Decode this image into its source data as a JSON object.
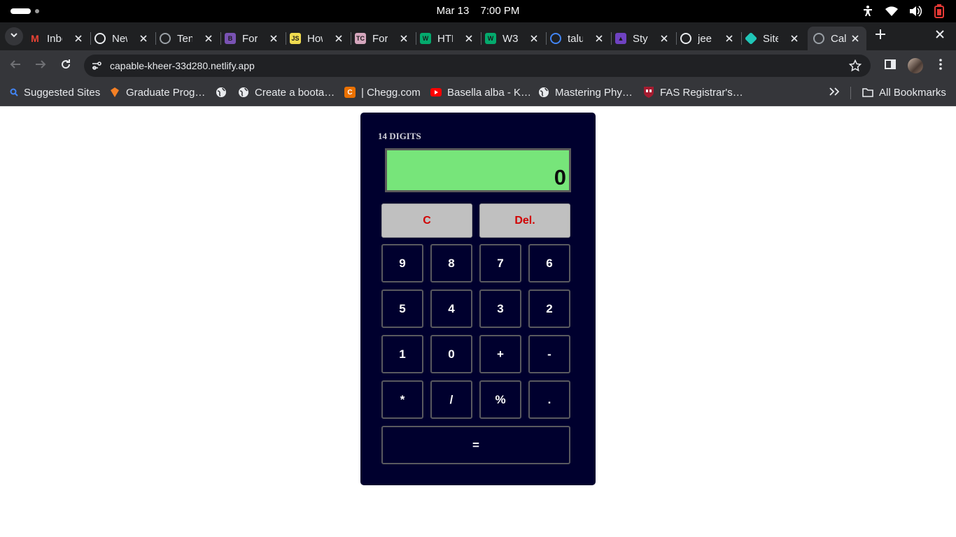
{
  "system": {
    "date": "Mar 13",
    "time": "7:00 PM",
    "tray_icons": [
      "accessibility-icon",
      "wifi-icon",
      "volume-icon",
      "battery-icon"
    ]
  },
  "tabs": [
    {
      "title": "Inbox",
      "icon": "gmail-icon",
      "color": "#ea4335"
    },
    {
      "title": "New",
      "icon": "chrome-icon",
      "color": "#e8eaed"
    },
    {
      "title": "Ten",
      "icon": "globe-icon",
      "color": "#9aa0a6"
    },
    {
      "title": "For",
      "icon": "bootstrap-icon",
      "color": "#7952b3"
    },
    {
      "title": "How",
      "icon": "javascript-icon",
      "color": "#f0db4f"
    },
    {
      "title": "For",
      "icon": "tc-icon",
      "color": "#d5a6bd"
    },
    {
      "title": "HTML",
      "icon": "w3schools-icon",
      "color": "#04aa6d"
    },
    {
      "title": "W3",
      "icon": "w3schools-icon",
      "color": "#04aa6d"
    },
    {
      "title": "talu",
      "icon": "google-icon",
      "color": "#4285f4"
    },
    {
      "title": "Styl",
      "icon": "styled-icon",
      "color": "#6f42c1"
    },
    {
      "title": "jee",
      "icon": "github-icon",
      "color": "#e8eaed"
    },
    {
      "title": "Site",
      "icon": "netlify-icon",
      "color": "#20c6b7"
    },
    {
      "title": "Cal",
      "icon": "globe-icon",
      "color": "#9aa0a6"
    }
  ],
  "toolbar": {
    "url": "capable-kheer-33d280.netlify.app"
  },
  "bookmarks": {
    "items": [
      {
        "label": "Suggested Sites",
        "icon": "search-icon",
        "color": "#4285f4"
      },
      {
        "label": "Graduate Prog…",
        "icon": "princeton-icon",
        "color": "#f58025"
      },
      {
        "label": "",
        "icon": "globe-icon",
        "color": "#e8eaed"
      },
      {
        "label": "Create a boota…",
        "icon": "globe-icon",
        "color": "#e8eaed"
      },
      {
        "label": "| Chegg.com",
        "icon": "chegg-icon",
        "color": "#eb7100"
      },
      {
        "label": "Basella alba - K…",
        "icon": "youtube-icon",
        "color": "#ff0000"
      },
      {
        "label": "Mastering Phy…",
        "icon": "globe-icon",
        "color": "#e8eaed"
      },
      {
        "label": "FAS Registrar's…",
        "icon": "harvard-icon",
        "color": "#a51c30"
      }
    ],
    "all_label": "All Bookmarks"
  },
  "calculator": {
    "title": "14 DIGITS",
    "display": "0",
    "clear_label": "C",
    "delete_label": "Del.",
    "keys": [
      "9",
      "8",
      "7",
      "6",
      "5",
      "4",
      "3",
      "2",
      "1",
      "0",
      "+",
      "-",
      "*",
      "/",
      "%",
      "."
    ],
    "equals_label": "=",
    "colors": {
      "body": "#00002e",
      "display": "#77e57a",
      "control_text": "#d10000"
    }
  }
}
